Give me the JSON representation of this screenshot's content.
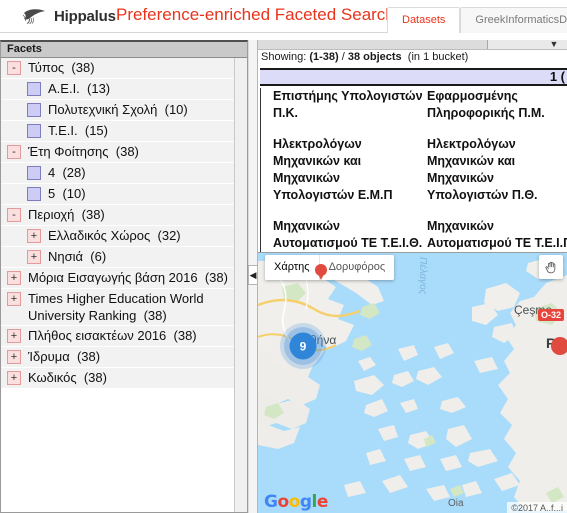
{
  "header": {
    "brand_name": "Hippalus",
    "logo_icon": "bird-logo-icon",
    "app_title": "Preference-enriched Faceted Search",
    "tabs": [
      {
        "label": "Datasets",
        "active": true
      },
      {
        "label": "GreekInformaticsDepart",
        "active": false
      }
    ]
  },
  "facets": {
    "header_label": "Facets",
    "rows": [
      {
        "indent": 0,
        "control": "minus",
        "label": "Τύπος",
        "count": "(38)"
      },
      {
        "indent": 1,
        "control": "checkbox",
        "label": "Α.Ε.Ι.",
        "count": "(13)"
      },
      {
        "indent": 1,
        "control": "checkbox",
        "label": "Πολυτεχνική Σχολή",
        "count": "(10)"
      },
      {
        "indent": 1,
        "control": "checkbox",
        "label": "Τ.Ε.Ι.",
        "count": "(15)"
      },
      {
        "indent": 0,
        "control": "minus",
        "label": "Έτη Φοίτησης",
        "count": "(38)"
      },
      {
        "indent": 1,
        "control": "checkbox",
        "label": "4",
        "count": "(28)"
      },
      {
        "indent": 1,
        "control": "checkbox",
        "label": "5",
        "count": "(10)"
      },
      {
        "indent": 0,
        "control": "minus",
        "label": "Περιοχή",
        "count": "(38)"
      },
      {
        "indent": 1,
        "control": "plus",
        "label": "Ελλαδικός Χώρος",
        "count": "(32)"
      },
      {
        "indent": 1,
        "control": "plus",
        "label": "Νησιά",
        "count": "(6)"
      },
      {
        "indent": 0,
        "control": "plus",
        "label": "Μόρια Εισαγωγής βάση 2016",
        "count": "(38)"
      },
      {
        "indent": 0,
        "control": "plus",
        "label": "Times Higher Education World University Ranking",
        "count": "(38)"
      },
      {
        "indent": 0,
        "control": "plus",
        "label": "Πλήθος εισακτέων 2016",
        "count": "(38)"
      },
      {
        "indent": 0,
        "control": "plus",
        "label": "Ίδρυμα",
        "count": "(38)"
      },
      {
        "indent": 0,
        "control": "plus",
        "label": "Κωδικός",
        "count": "(38)"
      }
    ]
  },
  "results": {
    "showing_prefix": "Showing:",
    "showing_range": "(1-38)",
    "showing_separator": "/",
    "showing_total": "38 objects",
    "showing_bucket": "(in 1 bucket)",
    "bucket_header_label": "1 (",
    "objects_col1": [
      "Επιστήμης Υπολογιστών Π.Κ.",
      "Ηλεκτρολόγων Μηχανικών και Μηχανικών Υπολογιστών Ε.Μ.Π",
      "Μηχανικών Αυτοματισμού ΤΕ Τ.Ε.Ι.Θ."
    ],
    "objects_col2": [
      "Εφαρμοσμένης Πληροφορικής Π.Μ.",
      "Ηλεκτρολόγων Μηχανικών και Μηχανικών Υπολογιστών Π.Θ.",
      "Μηχανικών Αυτοματισμού ΤΕ Τ.Ε.Ι.Π."
    ]
  },
  "map": {
    "type_buttons": [
      {
        "label": "Χάρτης",
        "selected": true
      },
      {
        "label": "Δορυφόρος",
        "selected": false
      }
    ],
    "pan_icon": "hand-pan-icon",
    "cluster_count": "9",
    "labels": [
      {
        "text": "Αθήνα",
        "kind": "city"
      },
      {
        "text": "Çeşme",
        "kind": "city"
      },
      {
        "text": "Ran",
        "kind": "big"
      },
      {
        "text": "Πέλαγος",
        "kind": "sea"
      },
      {
        "text": "Oia",
        "kind": "small"
      }
    ],
    "highway_shield": "O-32",
    "google_logo_letters": [
      "G",
      "o",
      "o",
      "g",
      "l",
      "e"
    ],
    "attribution": "©2017 A..f...i"
  },
  "colors": {
    "accent_red": "#e8341c",
    "facet_row_bg": "#f2f2f2",
    "checkbox_fill": "#ccccf5",
    "toggle_fill": "#fbdede",
    "bucket_bg": "#dcdcf8",
    "map_water": "#aadaff",
    "cluster_blue": "#2f86d8"
  }
}
